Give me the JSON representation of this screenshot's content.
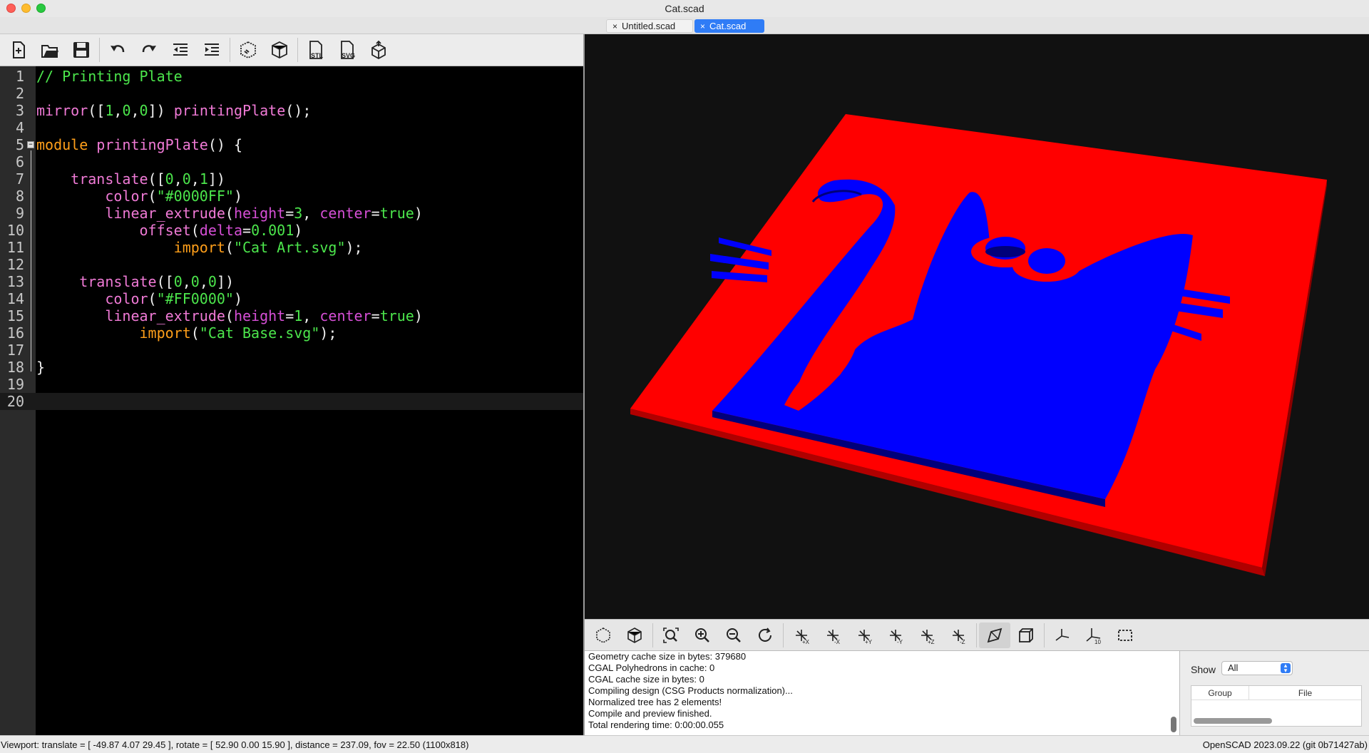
{
  "window": {
    "title": "Cat.scad"
  },
  "tabs": [
    {
      "label": "Untitled.scad",
      "close": "×"
    },
    {
      "label": "Cat.scad",
      "close": "×"
    }
  ],
  "editor_toolbar": {
    "stl_label": "STL",
    "svg_label": "SVG"
  },
  "editor": {
    "line_numbers": [
      "1",
      "2",
      "3",
      "4",
      "5",
      "6",
      "7",
      "8",
      "9",
      "10",
      "11",
      "12",
      "13",
      "14",
      "15",
      "16",
      "17",
      "18",
      "19",
      "20"
    ],
    "l1": "// Printing Plate",
    "l3_fn": "mirror",
    "l3_a": "([",
    "l3_n1": "1",
    "l3_c1": ",",
    "l3_n2": "0",
    "l3_c2": ",",
    "l3_n3": "0",
    "l3_b": "]) ",
    "l3_call": "printingPlate",
    "l3_end": "();",
    "l5_kw": "module",
    "l5_sp": " ",
    "l5_name": "printingPlate",
    "l5_end": "() {",
    "l7_ind": "    ",
    "l7_fn": "translate",
    "l7_a": "([",
    "l7_n1": "0",
    "l7_c1": ",",
    "l7_n2": "0",
    "l7_c2": ",",
    "l7_n3": "1",
    "l7_b": "])",
    "l8_ind": "        ",
    "l8_fn": "color",
    "l8_a": "(",
    "l8_s": "\"#0000FF\"",
    "l8_b": ")",
    "l9_ind": "        ",
    "l9_fn": "linear_extrude",
    "l9_a": "(",
    "l9_p1": "height",
    "l9_eq1": "=",
    "l9_v1": "3",
    "l9_c": ", ",
    "l9_p2": "center",
    "l9_eq2": "=",
    "l9_v2": "true",
    "l9_b": ")",
    "l10_ind": "            ",
    "l10_fn": "offset",
    "l10_a": "(",
    "l10_p": "delta",
    "l10_eq": "=",
    "l10_v": "0.001",
    "l10_b": ")",
    "l11_ind": "                ",
    "l11_fn": "import",
    "l11_a": "(",
    "l11_s": "\"Cat Art.svg\"",
    "l11_b": ");",
    "l13_ind": "     ",
    "l13_fn": "translate",
    "l13_a": "([",
    "l13_n1": "0",
    "l13_c1": ",",
    "l13_n2": "0",
    "l13_c2": ",",
    "l13_n3": "0",
    "l13_b": "])",
    "l14_ind": "        ",
    "l14_fn": "color",
    "l14_a": "(",
    "l14_s": "\"#FF0000\"",
    "l14_b": ")",
    "l15_ind": "        ",
    "l15_fn": "linear_extrude",
    "l15_a": "(",
    "l15_p1": "height",
    "l15_eq1": "=",
    "l15_v1": "1",
    "l15_c": ", ",
    "l15_p2": "center",
    "l15_eq2": "=",
    "l15_v2": "true",
    "l15_b": ")",
    "l16_ind": "            ",
    "l16_fn": "import",
    "l16_a": "(",
    "l16_s": "\"Cat Base.svg\"",
    "l16_b": ");",
    "l18": "}"
  },
  "viewport": {
    "plate_color": "#ff0000",
    "art_color": "#0000ff",
    "background": "#111111"
  },
  "console": {
    "lines": [
      "Geometry cache size in bytes: 379680",
      "CGAL Polyhedrons in cache: 0",
      "CGAL cache size in bytes: 0",
      "Compiling design (CSG Products normalization)...",
      "Normalized tree has 2 elements!",
      "Compile and preview finished.",
      "Total rendering time: 0:00:00.055"
    ]
  },
  "right_panel": {
    "show_label": "Show",
    "show_value": "All",
    "col_group": "Group",
    "col_file": "File"
  },
  "status": {
    "left": "Viewport: translate = [ -49.87 4.07 29.45 ], rotate = [ 52.90 0.00 15.90 ], distance = 237.09, fov = 22.50 (1100x818)",
    "right": "OpenSCAD 2023.09.22 (git 0b71427ab)"
  }
}
